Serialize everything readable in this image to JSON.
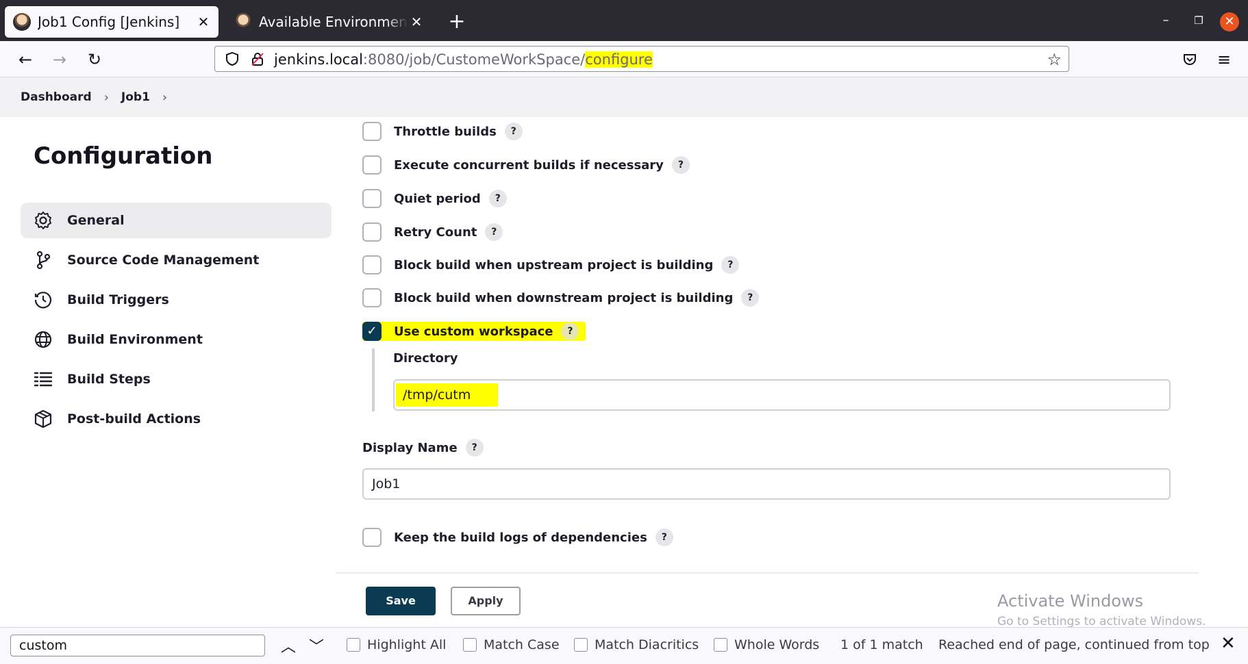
{
  "browser": {
    "tabs": [
      {
        "title": "Job1 Config [Jenkins]",
        "active": true
      },
      {
        "title": "Available Environmental Variables",
        "active": false
      }
    ],
    "new_tab_label": "+",
    "url": {
      "host": "jenkins.local",
      "path": ":8080/job/CustomeWorkSpace/",
      "highlight": "configure"
    }
  },
  "breadcrumb": [
    "Dashboard",
    "Job1"
  ],
  "page_title": "Configuration",
  "sidebar": {
    "items": [
      {
        "label": "General",
        "icon": "gear-icon",
        "active": true
      },
      {
        "label": "Source Code Management",
        "icon": "branch-icon",
        "active": false
      },
      {
        "label": "Build Triggers",
        "icon": "clock-icon",
        "active": false
      },
      {
        "label": "Build Environment",
        "icon": "globe-icon",
        "active": false
      },
      {
        "label": "Build Steps",
        "icon": "list-icon",
        "active": false
      },
      {
        "label": "Post-build Actions",
        "icon": "package-icon",
        "active": false
      }
    ]
  },
  "options": [
    {
      "label": "Throttle builds",
      "checked": false
    },
    {
      "label": "Execute concurrent builds if necessary",
      "checked": false
    },
    {
      "label": "Quiet period",
      "checked": false
    },
    {
      "label": "Retry Count",
      "checked": false
    },
    {
      "label": "Block build when upstream project is building",
      "checked": false
    },
    {
      "label": "Block build when downstream project is building",
      "checked": false
    },
    {
      "label": "Use custom workspace",
      "checked": true
    }
  ],
  "help_label": "?",
  "directory": {
    "label": "Directory",
    "value": "/tmp/cutm"
  },
  "display_name": {
    "label": "Display Name",
    "value": "Job1"
  },
  "keep_logs": {
    "label": "Keep the build logs of dependencies",
    "checked": false
  },
  "buttons": {
    "save": "Save",
    "apply": "Apply"
  },
  "watermark": {
    "title": "Activate Windows",
    "subtitle": "Go to Settings to activate Windows."
  },
  "findbar": {
    "query": "custom",
    "options": [
      "Highlight All",
      "Match Case",
      "Match Diacritics",
      "Whole Words"
    ],
    "status": "1 of 1 match",
    "message": "Reached end of page, continued from top"
  },
  "colors": {
    "primary": "#0b3b52",
    "highlight": "#ffff00",
    "titlebar": "#2b2a33",
    "close_button": "#e95420"
  }
}
